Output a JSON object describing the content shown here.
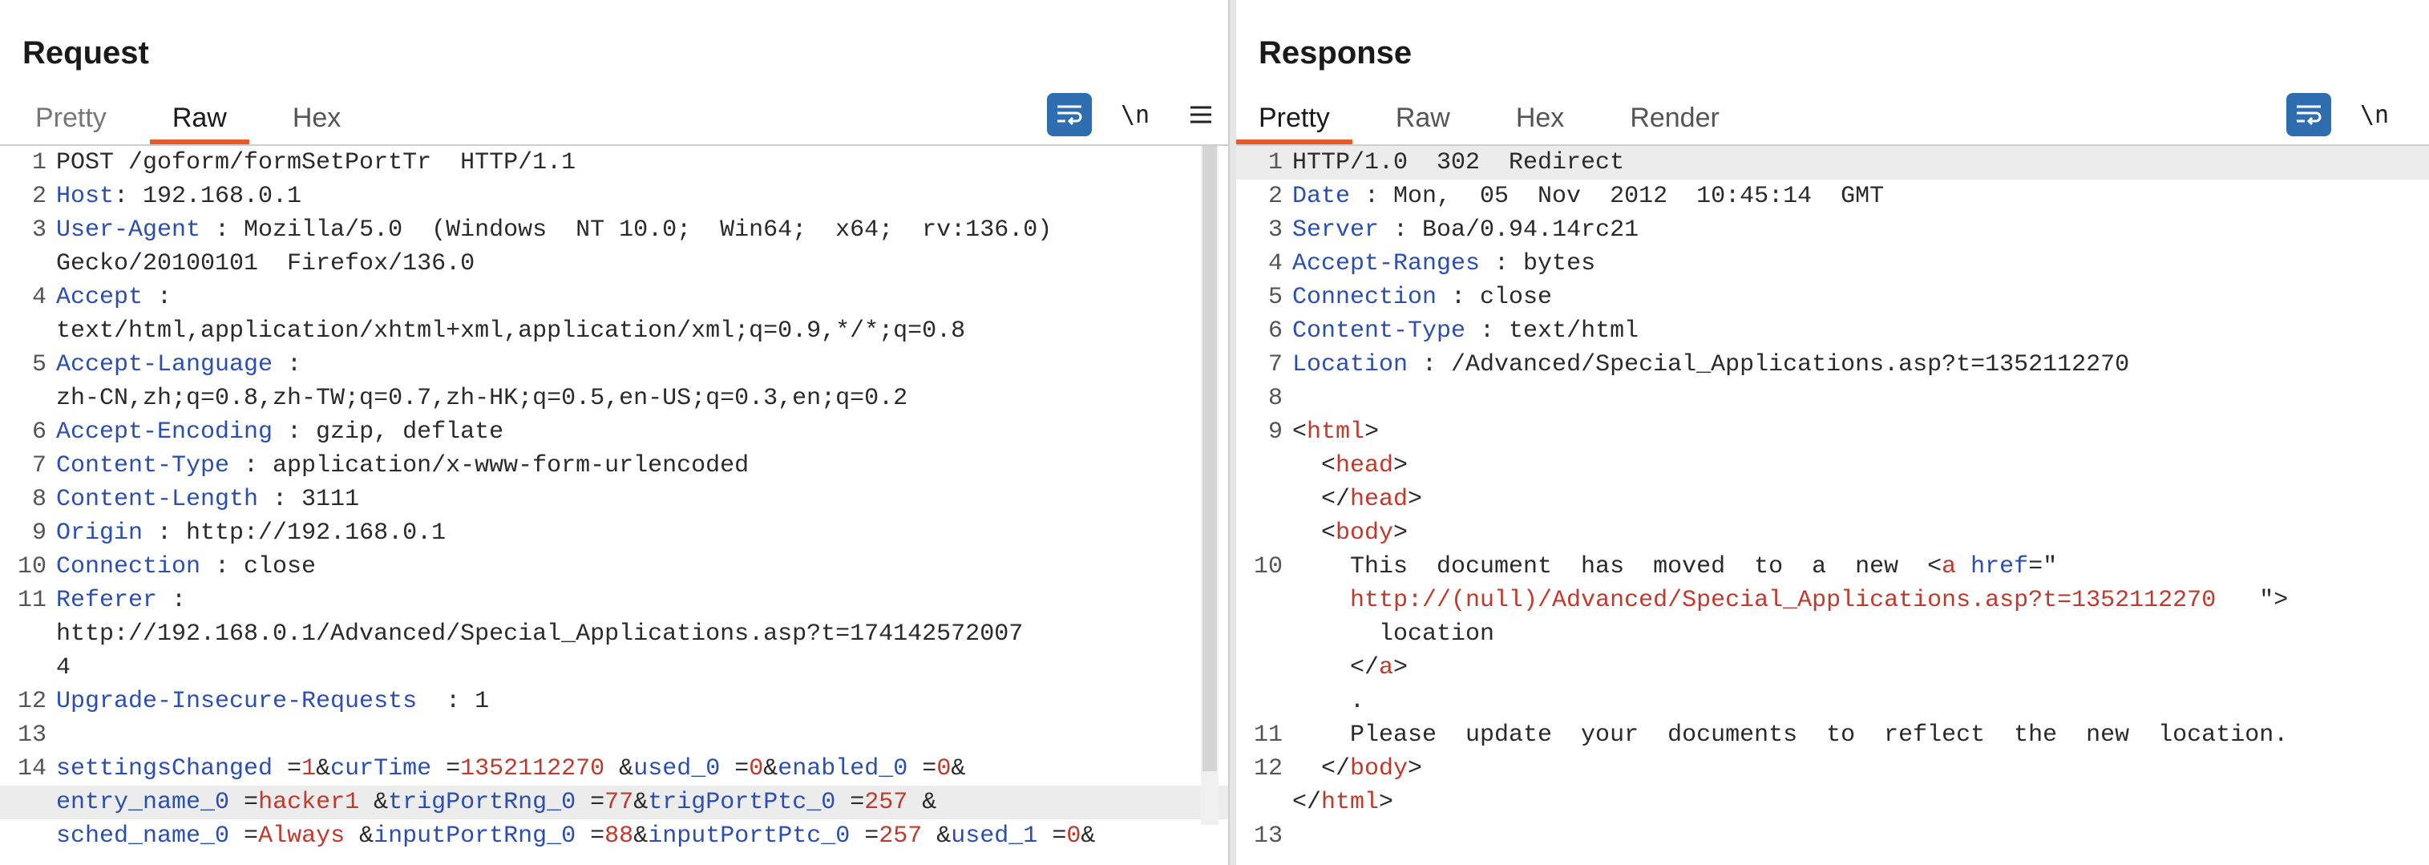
{
  "request": {
    "title": "Request",
    "tabs": [
      {
        "label": "Pretty",
        "active": false
      },
      {
        "label": "Raw",
        "active": true
      },
      {
        "label": "Hex",
        "active": false
      }
    ],
    "toolbar": {
      "newline_label": "\\n"
    }
  },
  "response": {
    "title": "Response",
    "tabs": [
      {
        "label": "Pretty",
        "active": true
      },
      {
        "label": "Raw",
        "active": false
      },
      {
        "label": "Hex",
        "active": false
      },
      {
        "label": "Render",
        "active": false
      }
    ],
    "toolbar": {
      "newline_label": "\\n"
    }
  },
  "request_lines": [
    {
      "n": "1",
      "segs": [
        {
          "t": "POST /goform/formSetPortTr  HTTP/1.1",
          "c": "v"
        }
      ]
    },
    {
      "n": "2",
      "segs": [
        {
          "t": "Host",
          "c": "k"
        },
        {
          "t": ": 192.168.0.1",
          "c": "v"
        }
      ]
    },
    {
      "n": "3",
      "segs": [
        {
          "t": "User-Agent",
          "c": "k"
        },
        {
          "t": " : Mozilla/5.0  (Windows  NT 10.0;  Win64;  x64;  rv:136.0)",
          "c": "v"
        }
      ]
    },
    {
      "n": "",
      "segs": [
        {
          "t": "Gecko/20100101  Firefox/136.0",
          "c": "v"
        }
      ]
    },
    {
      "n": "4",
      "segs": [
        {
          "t": "Accept",
          "c": "k"
        },
        {
          "t": " :",
          "c": "v"
        }
      ]
    },
    {
      "n": "",
      "segs": [
        {
          "t": "text/html,application/xhtml+xml,application/xml;q=0.9,*/*;q=0.8",
          "c": "v"
        }
      ]
    },
    {
      "n": "5",
      "segs": [
        {
          "t": "Accept-Language",
          "c": "k"
        },
        {
          "t": " :",
          "c": "v"
        }
      ]
    },
    {
      "n": "",
      "segs": [
        {
          "t": "zh-CN,zh;q=0.8,zh-TW;q=0.7,zh-HK;q=0.5,en-US;q=0.3,en;q=0.2",
          "c": "v"
        }
      ]
    },
    {
      "n": "6",
      "segs": [
        {
          "t": "Accept-Encoding",
          "c": "k"
        },
        {
          "t": " : gzip, deflate",
          "c": "v"
        }
      ]
    },
    {
      "n": "7",
      "segs": [
        {
          "t": "Content-Type",
          "c": "k"
        },
        {
          "t": " : application/x-www-form-urlencoded",
          "c": "v"
        }
      ]
    },
    {
      "n": "8",
      "segs": [
        {
          "t": "Content-Length",
          "c": "k"
        },
        {
          "t": " : 3111",
          "c": "v"
        }
      ]
    },
    {
      "n": "9",
      "segs": [
        {
          "t": "Origin",
          "c": "k"
        },
        {
          "t": " : http://192.168.0.1",
          "c": "v"
        }
      ]
    },
    {
      "n": "10",
      "segs": [
        {
          "t": "Connection",
          "c": "k"
        },
        {
          "t": " : close",
          "c": "v"
        }
      ]
    },
    {
      "n": "11",
      "segs": [
        {
          "t": "Referer",
          "c": "k"
        },
        {
          "t": " :",
          "c": "v"
        }
      ]
    },
    {
      "n": "",
      "segs": [
        {
          "t": "http://192.168.0.1/Advanced/Special_Applications.asp?t=174142572007",
          "c": "v"
        }
      ]
    },
    {
      "n": "",
      "segs": [
        {
          "t": "4",
          "c": "v"
        }
      ]
    },
    {
      "n": "12",
      "segs": [
        {
          "t": "Upgrade-Insecure-Requests",
          "c": "k"
        },
        {
          "t": "  : 1",
          "c": "v"
        }
      ]
    },
    {
      "n": "13",
      "segs": []
    },
    {
      "n": "14",
      "segs": [
        {
          "t": "settingsChanged",
          "c": "k"
        },
        {
          "t": " =",
          "c": "v"
        },
        {
          "t": "1",
          "c": "r"
        },
        {
          "t": "&",
          "c": "v"
        },
        {
          "t": "curTime",
          "c": "k"
        },
        {
          "t": " =",
          "c": "v"
        },
        {
          "t": "1352112270",
          "c": "r"
        },
        {
          "t": " &",
          "c": "v"
        },
        {
          "t": "used_0",
          "c": "k"
        },
        {
          "t": " =",
          "c": "v"
        },
        {
          "t": "0",
          "c": "r"
        },
        {
          "t": "&",
          "c": "v"
        },
        {
          "t": "enabled_0",
          "c": "k"
        },
        {
          "t": " =",
          "c": "v"
        },
        {
          "t": "0",
          "c": "r"
        },
        {
          "t": "&",
          "c": "v"
        }
      ]
    },
    {
      "n": "",
      "hl": true,
      "segs": [
        {
          "t": "entry_name_0",
          "c": "k"
        },
        {
          "t": " =",
          "c": "v"
        },
        {
          "t": "hacker1",
          "c": "r"
        },
        {
          "t": " &",
          "c": "v"
        },
        {
          "t": "trigPortRng_0",
          "c": "k"
        },
        {
          "t": " =",
          "c": "v"
        },
        {
          "t": "77",
          "c": "r"
        },
        {
          "t": "&",
          "c": "v"
        },
        {
          "t": "trigPortPtc_0",
          "c": "k"
        },
        {
          "t": " =",
          "c": "v"
        },
        {
          "t": "257",
          "c": "r"
        },
        {
          "t": " &",
          "c": "v"
        }
      ]
    },
    {
      "n": "",
      "segs": [
        {
          "t": "sched_name_0",
          "c": "k"
        },
        {
          "t": " =",
          "c": "v"
        },
        {
          "t": "Always",
          "c": "r"
        },
        {
          "t": " &",
          "c": "v"
        },
        {
          "t": "inputPortRng_0",
          "c": "k"
        },
        {
          "t": " =",
          "c": "v"
        },
        {
          "t": "88",
          "c": "r"
        },
        {
          "t": "&",
          "c": "v"
        },
        {
          "t": "inputPortPtc_0",
          "c": "k"
        },
        {
          "t": " =",
          "c": "v"
        },
        {
          "t": "257",
          "c": "r"
        },
        {
          "t": " &",
          "c": "v"
        },
        {
          "t": "used_1",
          "c": "k"
        },
        {
          "t": " =",
          "c": "v"
        },
        {
          "t": "0",
          "c": "r"
        },
        {
          "t": "&",
          "c": "v"
        }
      ]
    }
  ],
  "response_lines": [
    {
      "n": "1",
      "hl": true,
      "segs": [
        {
          "t": "HTTP/1.0  302  Redirect",
          "c": "v"
        }
      ]
    },
    {
      "n": "2",
      "segs": [
        {
          "t": "Date",
          "c": "k"
        },
        {
          "t": " : Mon,  05  Nov  2012  10:45:14  GMT",
          "c": "v"
        }
      ]
    },
    {
      "n": "3",
      "segs": [
        {
          "t": "Server",
          "c": "k"
        },
        {
          "t": " : Boa/0.94.14rc21",
          "c": "v"
        }
      ]
    },
    {
      "n": "4",
      "segs": [
        {
          "t": "Accept-Ranges",
          "c": "k"
        },
        {
          "t": " : bytes",
          "c": "v"
        }
      ]
    },
    {
      "n": "5",
      "segs": [
        {
          "t": "Connection",
          "c": "k"
        },
        {
          "t": " : close",
          "c": "v"
        }
      ]
    },
    {
      "n": "6",
      "segs": [
        {
          "t": "Content-Type",
          "c": "k"
        },
        {
          "t": " : text/html",
          "c": "v"
        }
      ]
    },
    {
      "n": "7",
      "segs": [
        {
          "t": "Location",
          "c": "k"
        },
        {
          "t": " : /Advanced/Special_Applications.asp?t=1352112270",
          "c": "v"
        }
      ]
    },
    {
      "n": "8",
      "segs": []
    },
    {
      "n": "9",
      "segs": [
        {
          "t": "<",
          "c": "v"
        },
        {
          "t": "html",
          "c": "tg"
        },
        {
          "t": ">",
          "c": "v"
        }
      ]
    },
    {
      "n": "",
      "segs": [
        {
          "t": "  <",
          "c": "v"
        },
        {
          "t": "head",
          "c": "tg"
        },
        {
          "t": ">",
          "c": "v"
        }
      ]
    },
    {
      "n": "",
      "segs": [
        {
          "t": "  </",
          "c": "v"
        },
        {
          "t": "head",
          "c": "tg"
        },
        {
          "t": ">",
          "c": "v"
        }
      ]
    },
    {
      "n": "",
      "segs": [
        {
          "t": "  <",
          "c": "v"
        },
        {
          "t": "body",
          "c": "tg"
        },
        {
          "t": ">",
          "c": "v"
        }
      ]
    },
    {
      "n": "10",
      "segs": [
        {
          "t": "    This  document  has  moved  to  a  new  <",
          "c": "v"
        },
        {
          "t": "a",
          "c": "tg"
        },
        {
          "t": " ",
          "c": "v"
        },
        {
          "t": "href",
          "c": "k"
        },
        {
          "t": "=\"",
          "c": "v"
        }
      ]
    },
    {
      "n": "",
      "segs": [
        {
          "t": "    ",
          "c": "v"
        },
        {
          "t": "http://(null)/Advanced/Special_Applications.asp?t=1352112270",
          "c": "r"
        },
        {
          "t": "   \">",
          "c": "v"
        }
      ]
    },
    {
      "n": "",
      "segs": [
        {
          "t": "      location",
          "c": "v"
        }
      ]
    },
    {
      "n": "",
      "segs": [
        {
          "t": "    </",
          "c": "v"
        },
        {
          "t": "a",
          "c": "tg"
        },
        {
          "t": ">",
          "c": "v"
        }
      ]
    },
    {
      "n": "",
      "segs": [
        {
          "t": "    .",
          "c": "v"
        }
      ]
    },
    {
      "n": "11",
      "segs": [
        {
          "t": "    Please  update  your  documents  to  reflect  the  new  location.",
          "c": "v"
        }
      ]
    },
    {
      "n": "12",
      "segs": [
        {
          "t": "  </",
          "c": "v"
        },
        {
          "t": "body",
          "c": "tg"
        },
        {
          "t": ">",
          "c": "v"
        }
      ]
    },
    {
      "n": "",
      "segs": [
        {
          "t": "</",
          "c": "v"
        },
        {
          "t": "html",
          "c": "tg"
        },
        {
          "t": ">",
          "c": "v"
        }
      ]
    },
    {
      "n": "13",
      "segs": []
    }
  ],
  "colors": {
    "accent": "#e8592b",
    "button_blue": "#2f6db1",
    "header_key": "#2b4fb0",
    "value_red": "#c0392b"
  },
  "icons": {
    "wrap": "word-wrap-icon",
    "menu": "hamburger-menu-icon",
    "layout_split": "side-by-side-layout-icon",
    "layout_stack": "stacked-layout-icon",
    "layout_single": "single-pane-layout-icon"
  }
}
